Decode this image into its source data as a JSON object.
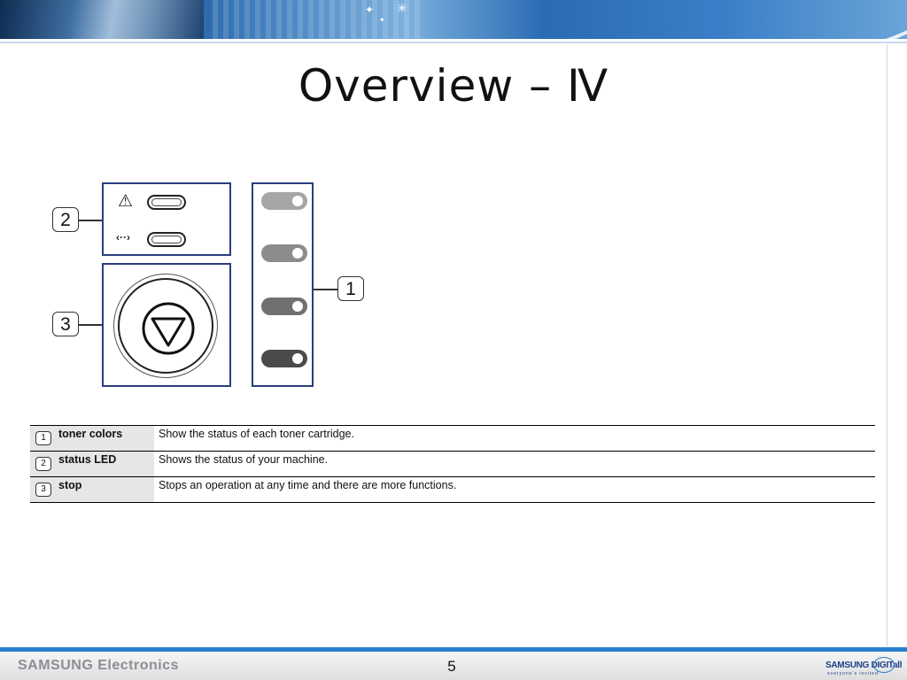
{
  "title": "Overview – Ⅳ",
  "callouts": {
    "one": "1",
    "two": "2",
    "three": "3"
  },
  "status_icons": {
    "warning_glyph": "⚠",
    "network_glyph": "‹··›"
  },
  "colors": {
    "panel_border": "#2a3d7c",
    "toner_1": "#a6a6a6",
    "toner_2": "#8c8c8c",
    "toner_3": "#707070",
    "toner_4": "#4a4a4a",
    "footer_accent": "#2c7fd0"
  },
  "table": [
    {
      "num": "1",
      "name": "toner colors",
      "desc": "Show the status of each toner cartridge."
    },
    {
      "num": "2",
      "name": "status LED",
      "desc": "Shows the status of your machine."
    },
    {
      "num": "3",
      "name": "stop",
      "desc": "Stops an operation at any time and there are more functions."
    }
  ],
  "footer": {
    "brand": "SAMSUNG Electronics",
    "page_number": "5",
    "logo_text": "SAMSUNG DIGITall",
    "logo_tagline": "everyone's invited"
  }
}
